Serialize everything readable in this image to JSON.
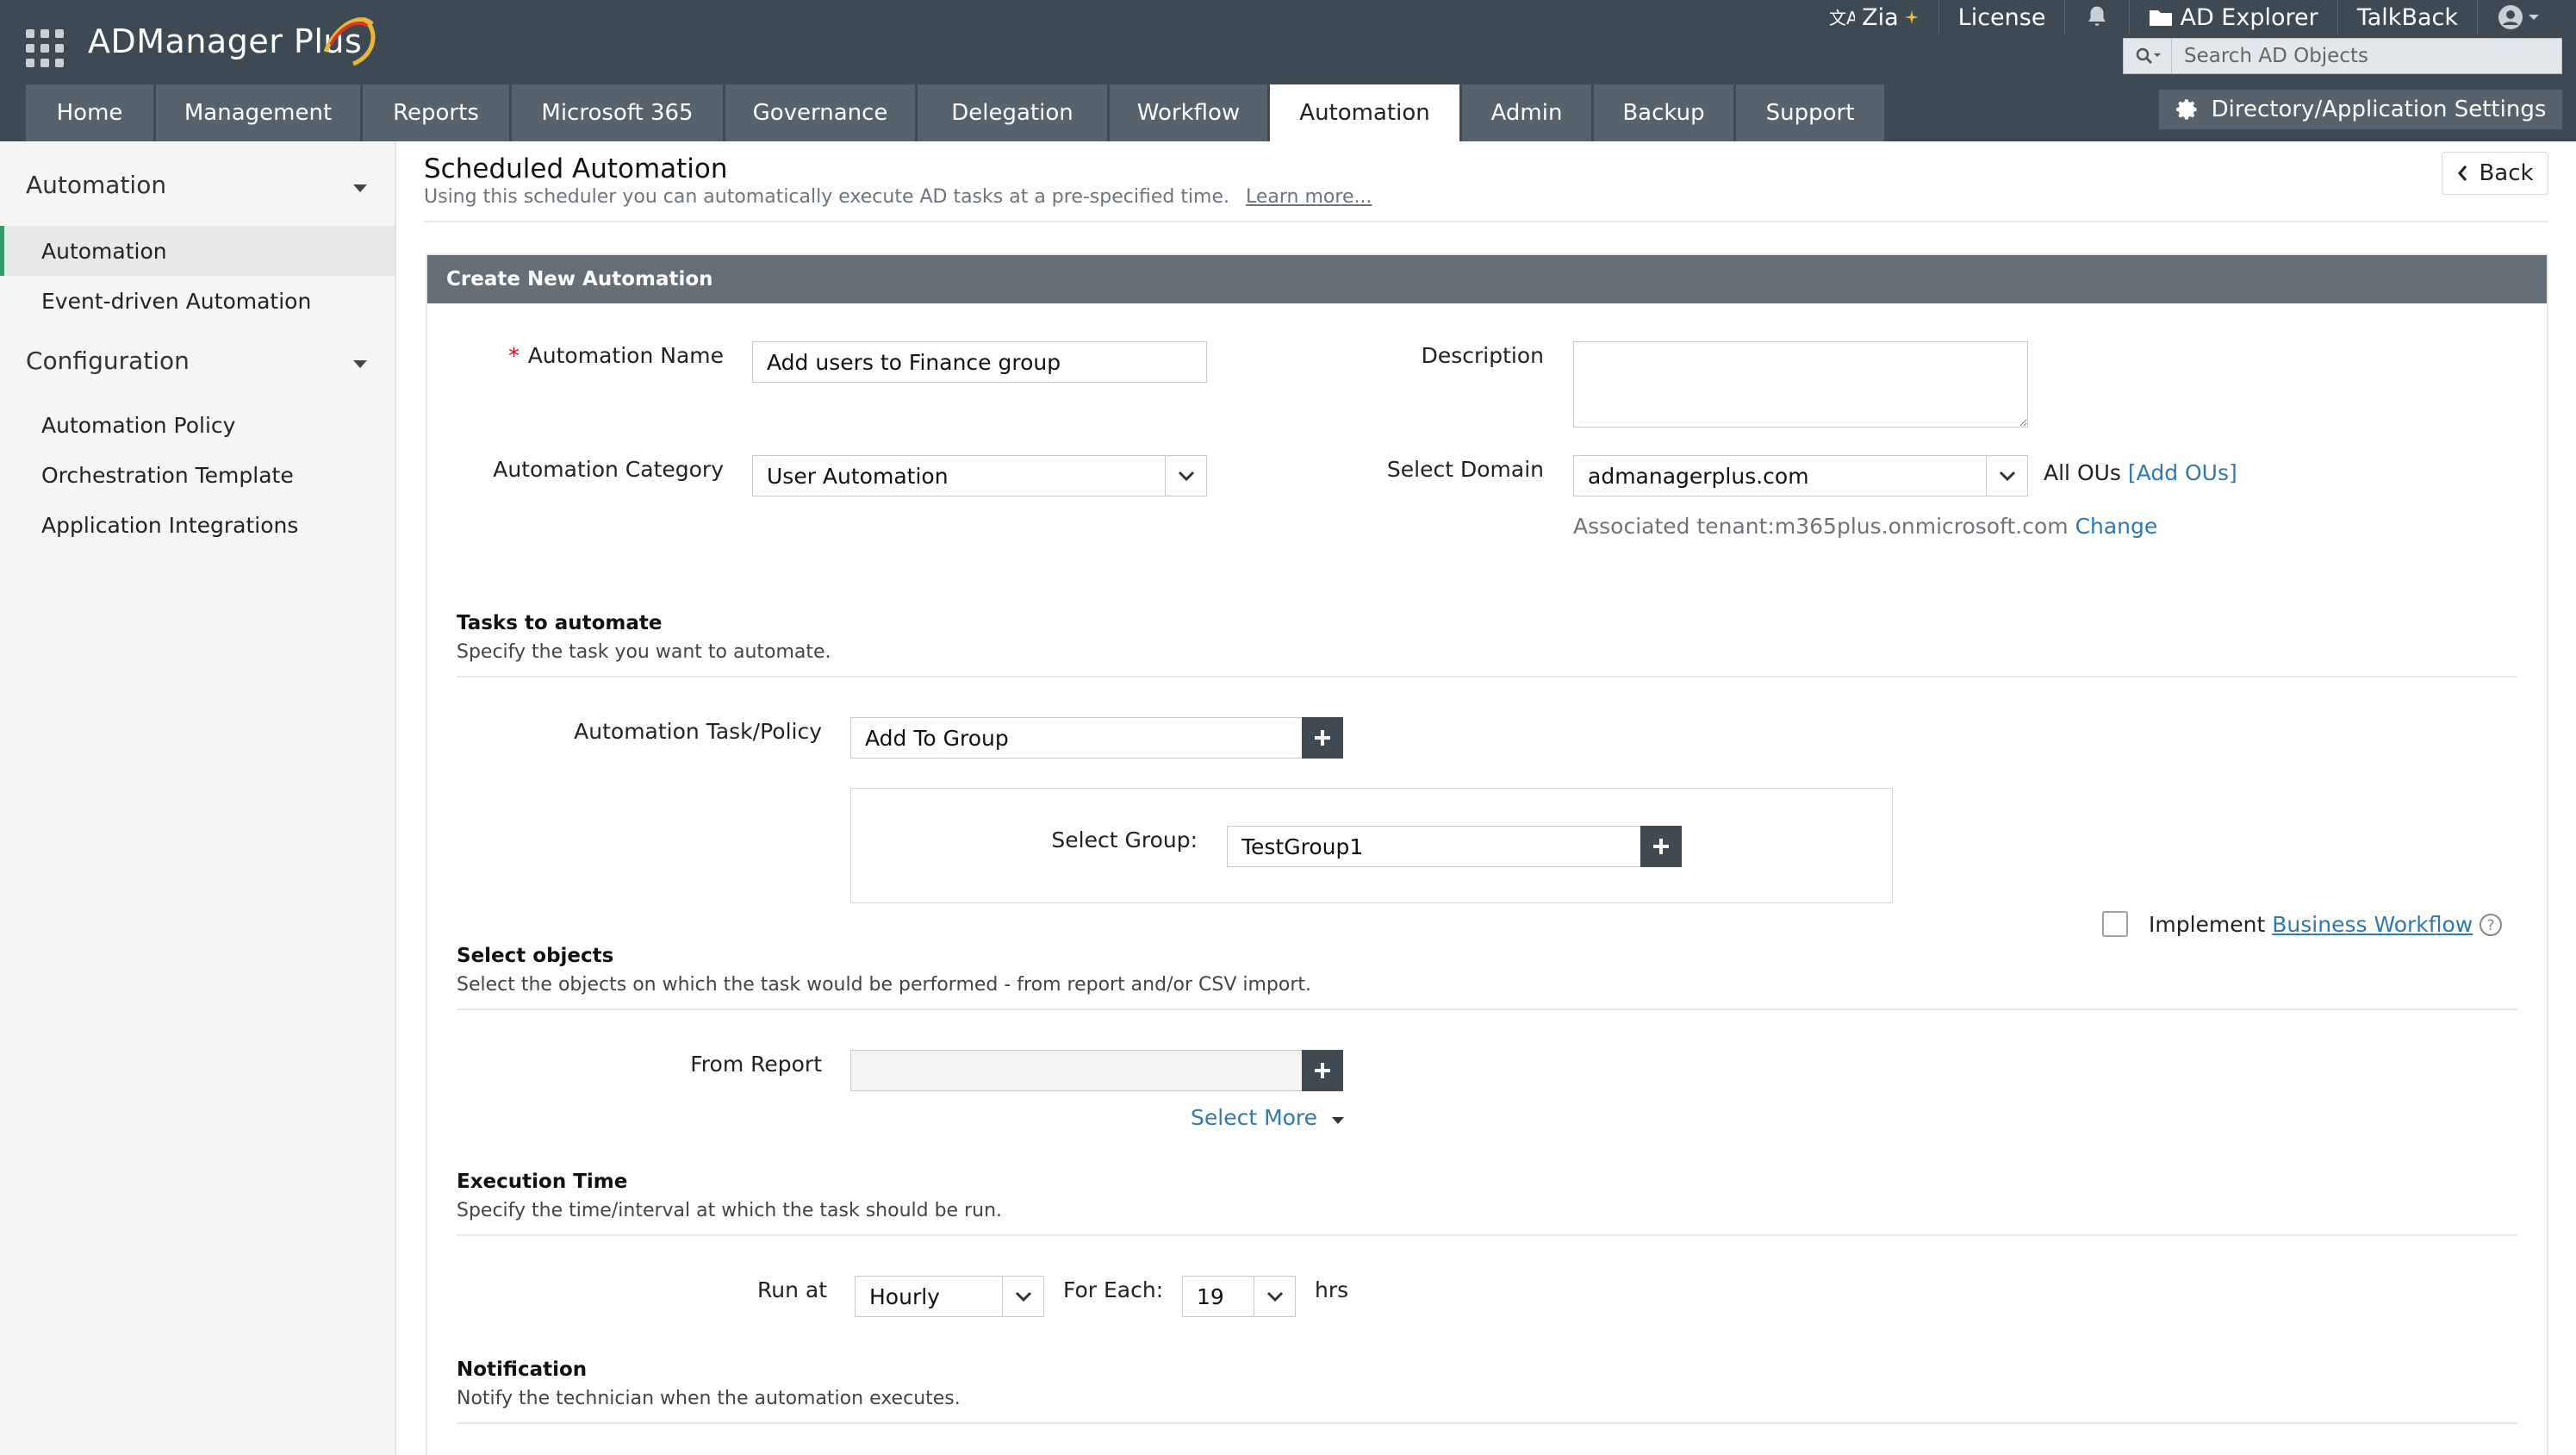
{
  "header": {
    "logo_text": "ADManager Plus",
    "zia_label": "Zia",
    "license_label": "License",
    "ad_explorer_label": "AD Explorer",
    "talkback_label": "TalkBack",
    "search_placeholder": "Search AD Objects"
  },
  "tabs": [
    {
      "label": "Home"
    },
    {
      "label": "Management"
    },
    {
      "label": "Reports"
    },
    {
      "label": "Microsoft 365"
    },
    {
      "label": "Governance"
    },
    {
      "label": "Delegation"
    },
    {
      "label": "Workflow"
    },
    {
      "label": "Automation",
      "active": true
    },
    {
      "label": "Admin"
    },
    {
      "label": "Backup"
    },
    {
      "label": "Support"
    }
  ],
  "settings_button": "Directory/Application Settings",
  "sidebar": {
    "section1": "Automation",
    "items1": [
      "Automation",
      "Event-driven Automation"
    ],
    "section2": "Configuration",
    "items2": [
      "Automation Policy",
      "Orchestration Template",
      "Application Integrations"
    ]
  },
  "page": {
    "title": "Scheduled Automation",
    "subtitle": "Using this scheduler you can automatically execute AD tasks at a pre-specified time.",
    "learn_more": "Learn more...",
    "back_label": "Back"
  },
  "form": {
    "panel_title": "Create New Automation",
    "name_label": "Automation Name",
    "name_value": "Add users to Finance group",
    "description_label": "Description",
    "description_value": "",
    "category_label": "Automation Category",
    "category_value": "User Automation",
    "domain_label": "Select Domain",
    "domain_value": "admanagerplus.com",
    "all_ous": "All OUs",
    "add_ous": "[Add OUs]",
    "tenant_text": "Associated tenant:m365plus.onmicrosoft.com",
    "change_link": "Change",
    "tasks_title": "Tasks to automate",
    "tasks_sub": "Specify the task you want to automate.",
    "task_label": "Automation Task/Policy",
    "task_value": "Add To Group",
    "group_label": "Select Group:",
    "group_value": "TestGroup1",
    "implement_label": "Implement",
    "business_workflow": "Business Workflow",
    "objects_title": "Select objects",
    "objects_sub": "Select the objects on which the task would be performed - from report and/or CSV import.",
    "from_report_label": "From Report",
    "from_report_value": "",
    "select_more": "Select More",
    "exec_title": "Execution Time",
    "exec_sub": "Specify the time/interval at which the task should be run.",
    "run_at_label": "Run at",
    "run_at_value": "Hourly",
    "for_each_label": "For Each:",
    "for_each_value": "19",
    "hrs_label": "hrs",
    "notif_title": "Notification",
    "notif_sub": "Notify the technician when the automation executes."
  },
  "colors": {
    "header_bg": "#3d4a53",
    "tab_bg": "#56636c",
    "panel_head_bg": "#646f78",
    "link": "#2d79b5",
    "active_marker": "#3a9a6e"
  }
}
